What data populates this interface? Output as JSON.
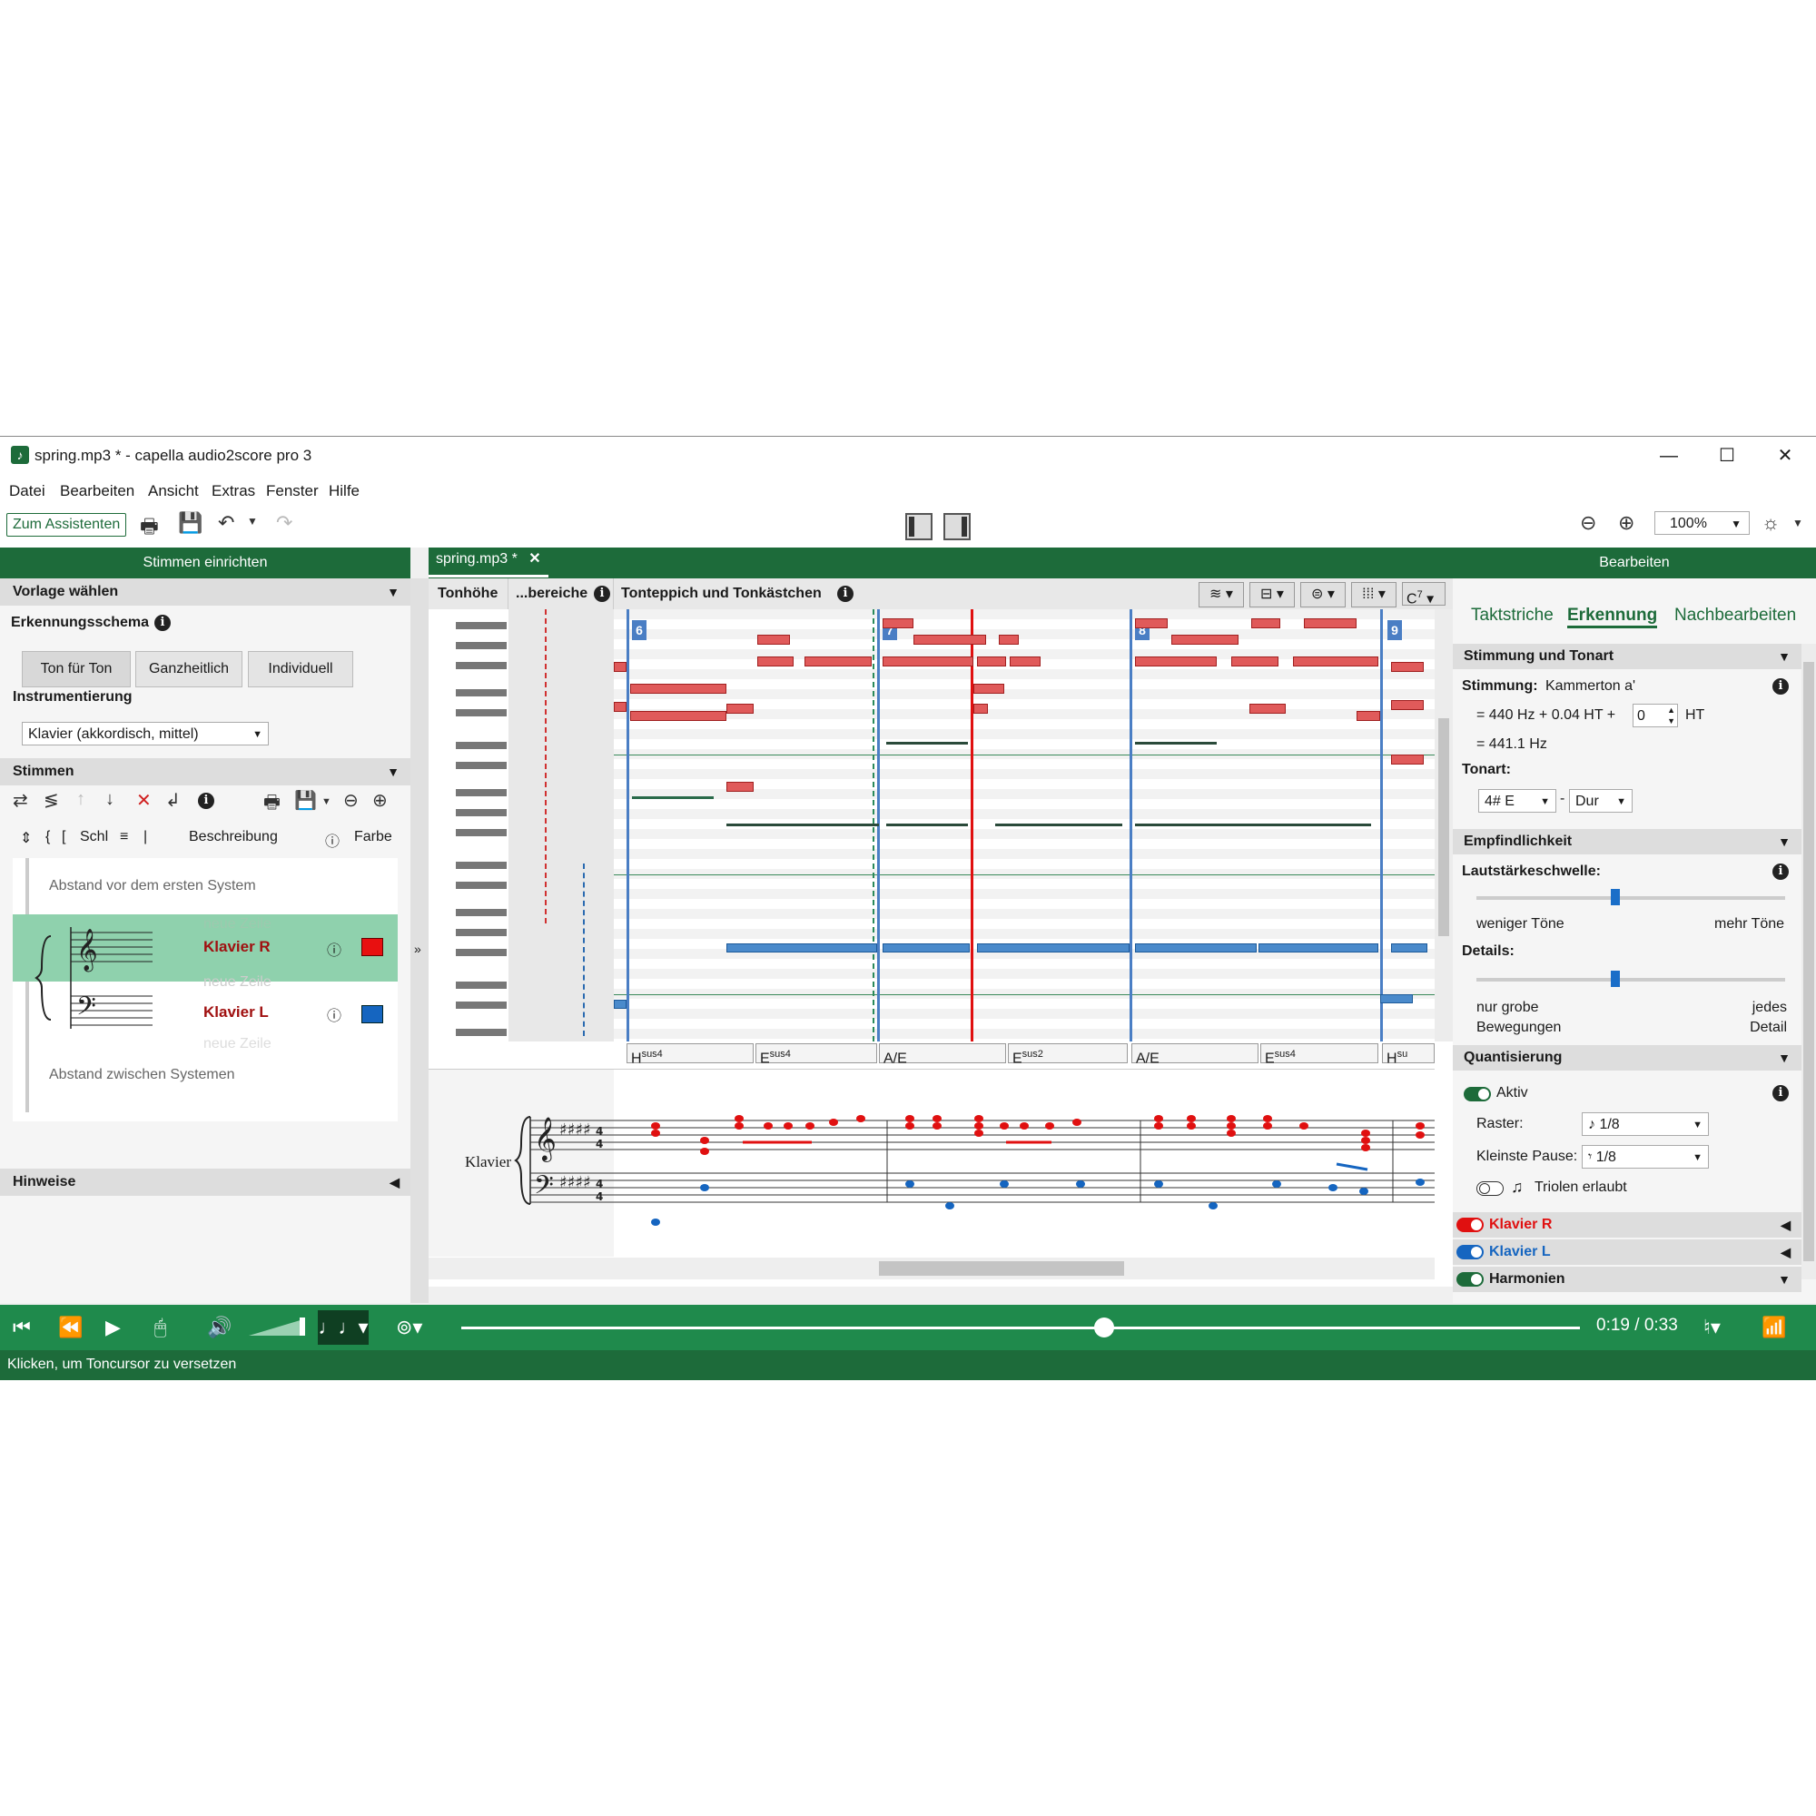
{
  "window": {
    "title": "spring.mp3 * - capella audio2score pro 3"
  },
  "menu": [
    "Datei",
    "Bearbeiten",
    "Ansicht",
    "Extras",
    "Fenster",
    "Hilfe"
  ],
  "toolbar": {
    "assistant_label": "Zum Assistenten",
    "zoom": "100%"
  },
  "left_panel": {
    "title": "Stimmen einrichten",
    "template_section": "Vorlage wählen",
    "scheme_label": "Erkennungsschema",
    "scheme_buttons": [
      "Ton für Ton",
      "Ganzheitlich",
      "Individuell"
    ],
    "instrumentation_label": "Instrumentierung",
    "instrumentation_value": "Klavier (akkordisch, mittel)",
    "voices_section": "Stimmen",
    "voice_columns": {
      "schl": "Schl",
      "desc": "Beschreibung",
      "color": "Farbe"
    },
    "spacing_first": "Abstand vor dem ersten System",
    "spacing_between": "Abstand zwischen Systemen",
    "new_line": "neue Zeile",
    "voices": [
      {
        "name": "Klavier R",
        "color": "#e81010"
      },
      {
        "name": "Klavier L",
        "color": "#1565c0"
      }
    ],
    "hints_section": "Hinweise"
  },
  "middle": {
    "tab": "spring.mp3 *",
    "col_pitch": "Tonhöhe",
    "col_ranges": "...bereiche",
    "col_carpet": "Tonteppich und Tonkästchen",
    "chord_key": "C",
    "chord_sup": "7",
    "measures": [
      "6",
      "7",
      "8",
      "9"
    ],
    "chords": [
      {
        "root": "H",
        "ext": "sus4"
      },
      {
        "root": "E",
        "ext": "sus4"
      },
      {
        "root": "A/E",
        "ext": ""
      },
      {
        "root": "E",
        "ext": "sus2"
      },
      {
        "root": "A/E",
        "ext": ""
      },
      {
        "root": "E",
        "ext": "sus4"
      },
      {
        "root": "H",
        "ext": "su"
      }
    ],
    "score_instrument": "Klavier",
    "collapse": "»"
  },
  "right_panel": {
    "title": "Bearbeiten",
    "tabs": [
      "Taktstriche",
      "Erkennung",
      "Nachbearbeiten"
    ],
    "tuning_section": "Stimmung und Tonart",
    "tuning_label": "Stimmung:",
    "tuning_value": "Kammerton a'",
    "tuning_formula": "= 440 Hz + 0.04 HT +",
    "tuning_ht": "0",
    "tuning_ht_unit": "HT",
    "tuning_result": "= 441.1 Hz",
    "key_label": "Tonart:",
    "key_value": "4# E",
    "key_sep": "-",
    "key_mode": "Dur",
    "sensitivity_section": "Empfindlichkeit",
    "volume_label": "Lautstärkeschwelle:",
    "volume_level": 0.45,
    "volume_left": "weniger Töne",
    "volume_right": "mehr Töne",
    "details_label": "Details:",
    "details_level": 0.45,
    "details_left": "nur grobe Bewegungen",
    "details_right": "jedes Detail",
    "quant_section": "Quantisierung",
    "quant_active": "Aktiv",
    "raster_label": "Raster:",
    "raster_value": "♪ 1/8",
    "pause_label": "Kleinste Pause:",
    "pause_value": "𝄾 1/8",
    "triplets": "Triolen erlaubt",
    "voice_sections": [
      {
        "name": "Klavier R",
        "color": "#e81010"
      },
      {
        "name": "Klavier L",
        "color": "#1565c0"
      },
      {
        "name": "Harmonien",
        "color": "#1a1a1a"
      }
    ]
  },
  "player": {
    "time": "0:19 / 0:33",
    "progress": 0.575
  },
  "status": "Klicken, um Toncursor zu versetzen"
}
